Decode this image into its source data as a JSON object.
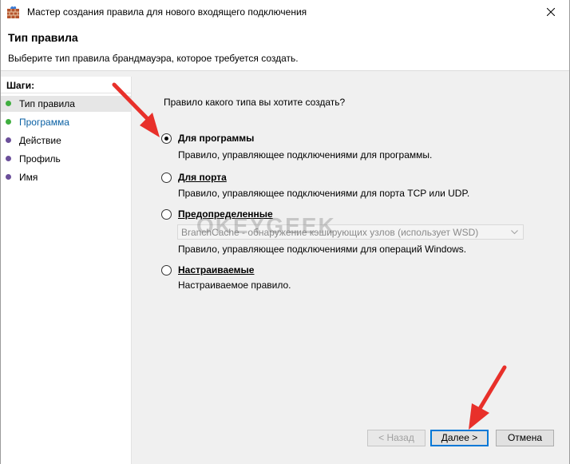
{
  "window": {
    "title": "Мастер создания правила для нового входящего подключения"
  },
  "header": {
    "title": "Тип правила",
    "subtitle": "Выберите тип правила брандмауэра, которое требуется создать."
  },
  "steps": {
    "title": "Шаги:",
    "items": [
      {
        "label": "Тип правила",
        "state": "current",
        "dot_color": "#3fae3f",
        "text_color": "#000000"
      },
      {
        "label": "Программа",
        "state": "link",
        "dot_color": "#3fae3f",
        "text_color": "#0b61a4"
      },
      {
        "label": "Действие",
        "state": "pending",
        "dot_color": "#6b4f9a",
        "text_color": "#000000"
      },
      {
        "label": "Профиль",
        "state": "pending",
        "dot_color": "#6b4f9a",
        "text_color": "#000000"
      },
      {
        "label": "Имя",
        "state": "pending",
        "dot_color": "#6b4f9a",
        "text_color": "#000000"
      }
    ]
  },
  "content": {
    "question": "Правило какого типа вы хотите создать?",
    "options": [
      {
        "label": "Для программы",
        "description": "Правило, управляющее подключениями для программы.",
        "selected": true
      },
      {
        "label": "Для порта",
        "description": "Правило, управляющее подключениями для порта TCP или UDP.",
        "selected": false
      },
      {
        "label": "Предопределенные",
        "combo_value": "BranchCache - обнаружение кэширующих узлов (использует WSD)",
        "description": "Правило, управляющее подключениями для операций Windows.",
        "selected": false
      },
      {
        "label": "Настраиваемые",
        "description": "Настраиваемое правило.",
        "selected": false
      }
    ]
  },
  "watermark": "OKEYGEEK",
  "buttons": {
    "back": "< Назад",
    "next": "Далее >",
    "cancel": "Отмена"
  },
  "colors": {
    "annotation_arrow": "#e8302a",
    "focus_blue": "#0078d7"
  },
  "icons": {
    "app": "firewall-wall-icon",
    "close": "close-icon",
    "combo": "chevron-down-icon"
  }
}
